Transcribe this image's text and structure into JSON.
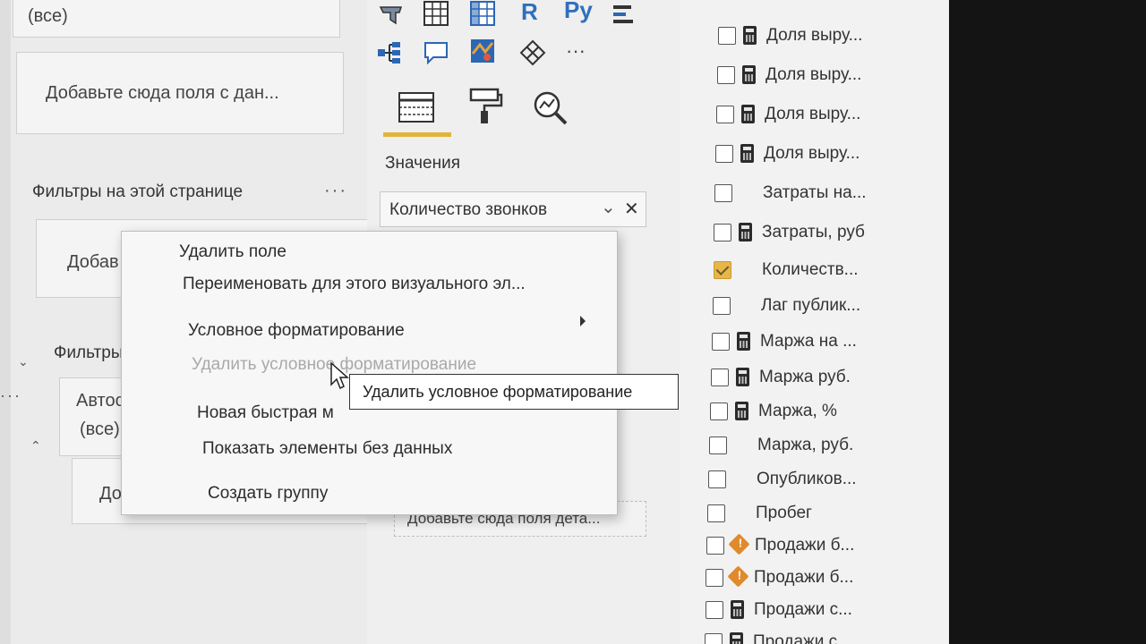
{
  "filters": {
    "top_card_value": "(все)",
    "visual_add_placeholder": "Добавьте сюда поля с дан...",
    "page_heading": "Фильтры на этой странице",
    "page_add_prefix": "Добав",
    "all_heading_prefix": "Фильтры",
    "card_title_prefix": "Автоса",
    "card_value": "(все)",
    "all_add_prefix": "Добав",
    "more_label": "···"
  },
  "viz": {
    "icons_row1": [
      "filled-map-icon",
      "table-icon",
      "matrix-icon",
      "r-visual-icon",
      "python-visual-icon",
      "key-influencers-icon"
    ],
    "icons_row2": [
      "decomposition-tree-icon",
      "qna-icon",
      "arcgis-map-icon",
      "power-apps-icon",
      "more-visuals-icon"
    ],
    "r_label": "R",
    "py_label": "Py",
    "more_label": "···",
    "tabs": [
      "fields-tab",
      "format-tab",
      "analytics-tab"
    ],
    "values_heading": "Значения",
    "value_field": "Количество звонков",
    "details_placeholder": "Добавьте сюда поля дета..."
  },
  "context_menu": {
    "items": [
      {
        "label": "Удалить поле",
        "enabled": true
      },
      {
        "label": "Переименовать для этого визуального эл...",
        "enabled": true
      },
      {
        "label": "Условное форматирование",
        "enabled": true,
        "submenu": true
      },
      {
        "label": "Удалить условное форматирование",
        "enabled": false
      },
      {
        "label": "Новая быстрая м",
        "enabled": true
      },
      {
        "label": "Показать элементы без данных",
        "enabled": true
      },
      {
        "label": "Создать группу",
        "enabled": true
      }
    ]
  },
  "tooltip": {
    "text": "Удалить условное форматирование"
  },
  "fields": {
    "items": [
      {
        "name": "Доля выру...",
        "icon": "calculator-icon",
        "checked": false
      },
      {
        "name": "Доля выру...",
        "icon": "calculator-icon",
        "checked": false
      },
      {
        "name": "Доля выру...",
        "icon": "calculator-icon",
        "checked": false
      },
      {
        "name": "Доля выру...",
        "icon": "calculator-icon",
        "checked": false
      },
      {
        "name": "Затраты на...",
        "icon": "",
        "checked": false
      },
      {
        "name": "Затраты, руб",
        "icon": "calculator-icon",
        "checked": false
      },
      {
        "name": "Количеств...",
        "icon": "",
        "checked": true
      },
      {
        "name": "Лаг публик...",
        "icon": "",
        "checked": false
      },
      {
        "name": "Маржа на ...",
        "icon": "calculator-icon",
        "checked": false
      },
      {
        "name": "Маржа руб.",
        "icon": "calculator-icon",
        "checked": false
      },
      {
        "name": "Маржа, %",
        "icon": "calculator-icon",
        "checked": false
      },
      {
        "name": "Маржа, руб.",
        "icon": "",
        "checked": false
      },
      {
        "name": "Опубликов...",
        "icon": "",
        "checked": false
      },
      {
        "name": "Пробег",
        "icon": "",
        "checked": false
      },
      {
        "name": "Продажи б...",
        "icon": "warning-icon",
        "checked": false
      },
      {
        "name": "Продажи б...",
        "icon": "warning-icon",
        "checked": false
      },
      {
        "name": "Продажи с...",
        "icon": "calculator-icon",
        "checked": false
      },
      {
        "name": "Продажи с...",
        "icon": "calculator-icon",
        "checked": false
      }
    ]
  },
  "colors": {
    "accent": "#e2b33a",
    "checked_box": "#e7b64a",
    "warning": "#e08a2c"
  }
}
